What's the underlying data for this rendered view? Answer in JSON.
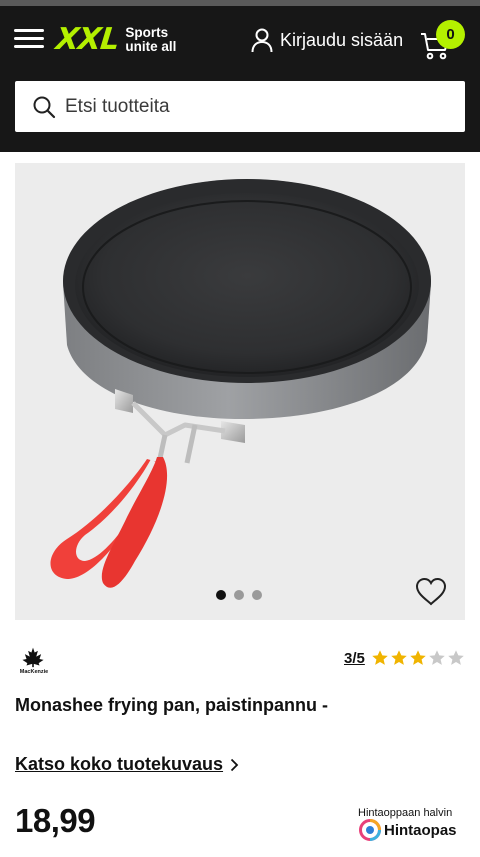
{
  "header": {
    "logo_mark": "XXL",
    "logo_tag_line1": "Sports",
    "logo_tag_line2": "unite all",
    "login_label": "Kirjaudu sisään",
    "cart_count": "0",
    "brand_color": "#b4f000",
    "background_color": "#171717"
  },
  "search": {
    "placeholder": "Etsi tuotteita",
    "value": ""
  },
  "gallery": {
    "image_alt": "Monashee frying pan",
    "image_count": 3,
    "active_image": 1
  },
  "product": {
    "brand": "MacKenzie",
    "rating_text": "3/5",
    "rating": 3,
    "rating_max": 5,
    "title": "Monashee frying pan, paistinpannu -",
    "description_link": "Katso koko tuotekuvaus",
    "price": "18,99"
  },
  "hintaopas": {
    "caption": "Hintaoppaan halvin",
    "name": "Hintaopas"
  },
  "icons": {
    "menu": "menu-icon",
    "user": "user-icon",
    "cart": "cart-icon",
    "search": "search-icon",
    "wishlist": "heart-icon",
    "chevron": "chevron-right-icon",
    "star": "star-icon"
  },
  "colors": {
    "star_filled": "#f0b400",
    "star_empty": "#c8c8c8",
    "pan_handle": "#f0403a"
  }
}
